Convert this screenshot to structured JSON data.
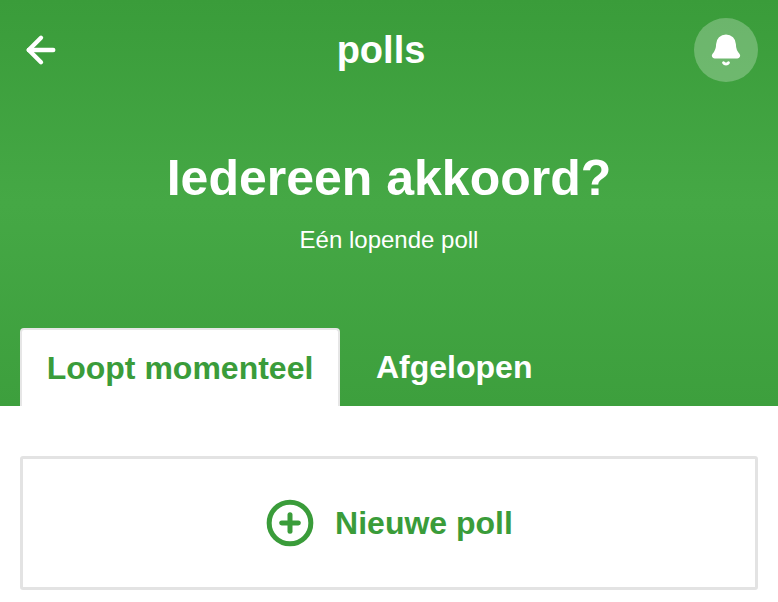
{
  "header": {
    "title": "polls",
    "heading": "Iedereen akkoord?",
    "subtitle": "Eén lopende poll"
  },
  "tabs": [
    {
      "label": "Loopt momenteel",
      "selected": true
    },
    {
      "label": "Afgelopen",
      "selected": false
    }
  ],
  "new_poll_button": {
    "label": "Nieuwe poll"
  }
}
